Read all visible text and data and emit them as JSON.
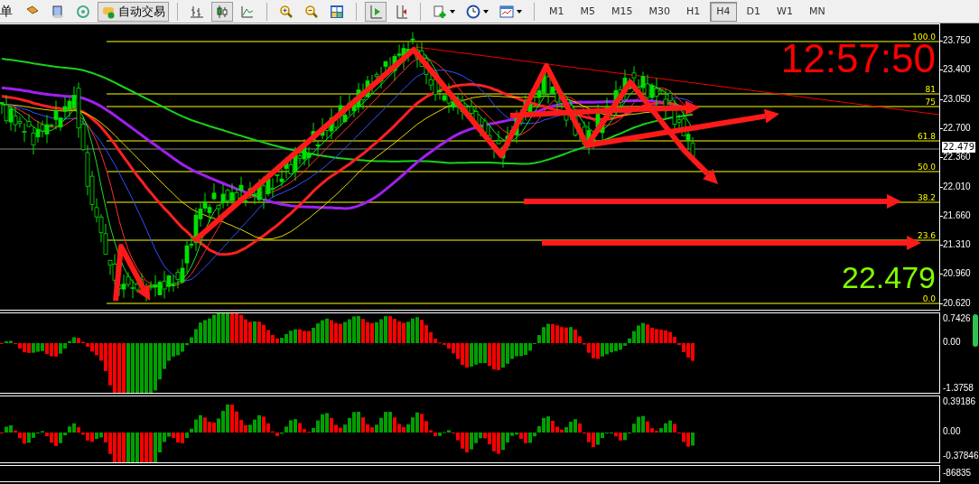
{
  "toolbar": {
    "menu_fragment": "单",
    "autotrade_label": "自动交易"
  },
  "timeframes": [
    {
      "label": "M1",
      "selected": false
    },
    {
      "label": "M5",
      "selected": false
    },
    {
      "label": "M15",
      "selected": false
    },
    {
      "label": "M30",
      "selected": false
    },
    {
      "label": "H1",
      "selected": false
    },
    {
      "label": "H4",
      "selected": true
    },
    {
      "label": "D1",
      "selected": false
    },
    {
      "label": "W1",
      "selected": false
    },
    {
      "label": "MN",
      "selected": false
    }
  ],
  "main_chart": {
    "clock": "12:57:50",
    "bid_price": "22.479",
    "current_price_tag": "22.479",
    "price_axis": [
      "23.750",
      "23.400",
      "23.050",
      "22.700",
      "22.360",
      "22.010",
      "21.660",
      "21.310",
      "20.960",
      "20.620"
    ],
    "fibonacci_labels": [
      "100.0",
      "81",
      "75",
      "61.8",
      "50.0",
      "38.2",
      "23.6",
      "0.0"
    ]
  },
  "indicator_1": {
    "axis": [
      "0.7426",
      "0.00",
      "-1.3758"
    ]
  },
  "indicator_2": {
    "axis": [
      "0.39186",
      "0.00",
      "-0.37846"
    ]
  },
  "indicator_3": {
    "axis": [
      "-86835"
    ]
  }
}
